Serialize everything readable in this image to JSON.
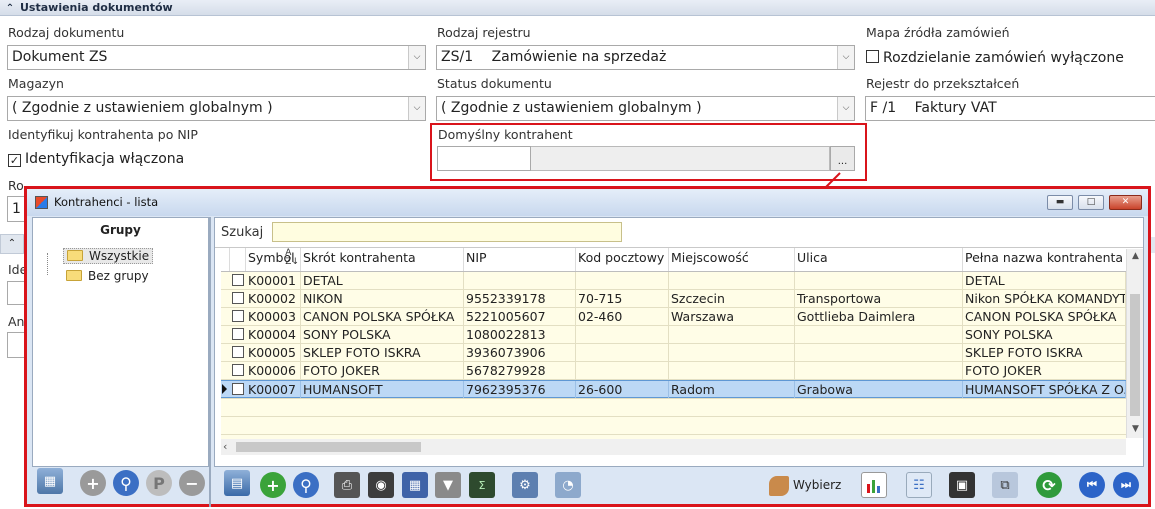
{
  "settings": {
    "section_title": "Ustawienia dokumentów",
    "doc_type_label": "Rodzaj dokumentu",
    "doc_type_value": "Dokument ZS",
    "register_label": "Rodzaj rejestru",
    "register_code": "ZS/1",
    "register_name": "Zamówienie na sprzedaż",
    "source_map_label": "Mapa źródła zamówień",
    "split_orders_label": "Rozdzielanie zamówień wyłączone",
    "warehouse_label": "Magazyn",
    "warehouse_value": "( Zgodnie z ustawieniem globalnym )",
    "doc_status_label": "Status dokumentu",
    "doc_status_value": "( Zgodnie z ustawieniem globalnym )",
    "convert_register_label": "Rejestr do przekształceń",
    "convert_register_code": "F /1",
    "convert_register_name": "Faktury VAT",
    "identify_label": "Identyfikuj kontrahenta po NIP",
    "identify_check_label": "Identyfikacja włączona",
    "default_contractor_label": "Domyślny kontrahent",
    "partial_label_1": "Ro",
    "partial_value_1": "1",
    "partial_label_2": "Ide",
    "partial_label_3": "An",
    "ellipsis": "..."
  },
  "popup": {
    "title": "Kontrahenci - lista",
    "groups_title": "Grupy",
    "groups": [
      "Wszystkie",
      "Bez grupy"
    ],
    "search_label": "Szukaj",
    "search_value": "",
    "columns": [
      "Symbol",
      "Skrót kontrahenta",
      "NIP",
      "Kod pocztowy",
      "Miejscowość",
      "Ulica",
      "Pełna nazwa kontrahenta"
    ],
    "rows": [
      {
        "symbol": "K00001",
        "short": "DETAL",
        "nip": "",
        "postal": "",
        "city": "",
        "street": "",
        "full": "DETAL"
      },
      {
        "symbol": "K00002",
        "short": "NIKON",
        "nip": "9552339178",
        "postal": "70-715",
        "city": "Szczecin",
        "street": "Transportowa",
        "full": "Nikon SPÓŁKA KOMANDYTOWA"
      },
      {
        "symbol": "K00003",
        "short": "CANON POLSKA SPÓŁKA",
        "nip": "5221005607",
        "postal": "02-460",
        "city": "Warszawa",
        "street": "Gottlieba Daimlera",
        "full": "CANON POLSKA SPÓŁKA"
      },
      {
        "symbol": "K00004",
        "short": "SONY POLSKA",
        "nip": "1080022813",
        "postal": "",
        "city": "",
        "street": "",
        "full": "SONY POLSKA"
      },
      {
        "symbol": "K00005",
        "short": "SKLEP FOTO ISKRA",
        "nip": "3936073906",
        "postal": "",
        "city": "",
        "street": "",
        "full": "SKLEP FOTO ISKRA"
      },
      {
        "symbol": "K00006",
        "short": "FOTO JOKER",
        "nip": "5678279928",
        "postal": "",
        "city": "",
        "street": "",
        "full": "FOTO JOKER"
      },
      {
        "symbol": "K00007",
        "short": "HUMANSOFT",
        "nip": "7962395376",
        "postal": "26-600",
        "city": "Radom",
        "street": "Grabowa",
        "full": "HUMANSOFT SPÓŁKA Z O.O."
      }
    ],
    "selected_row": 6,
    "choose_label": "Wybierz",
    "group_buttons": [
      "P"
    ],
    "colors": {
      "highlight": "#d9141b",
      "selection": "#bcd8f5",
      "row_bg": "#fffde7"
    }
  }
}
